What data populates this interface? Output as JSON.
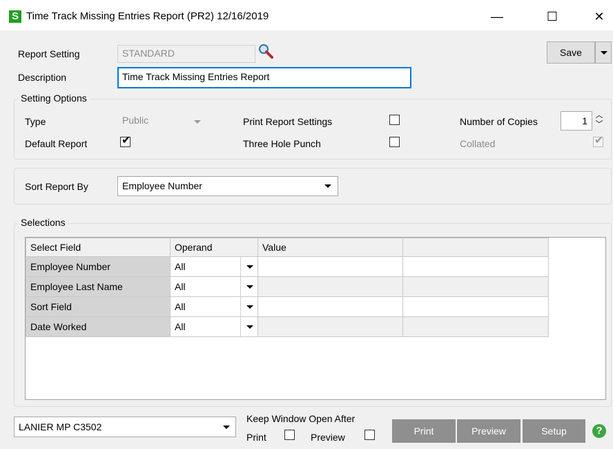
{
  "window": {
    "app_letter": "S",
    "title": "Time Track Missing Entries Report (PR2) 12/16/2019",
    "controls": {
      "minimize": "—",
      "maximize": "☐",
      "close": "✕"
    }
  },
  "header": {
    "report_setting_label": "Report Setting",
    "report_setting_value": "STANDARD",
    "description_label": "Description",
    "description_value": "Time Track Missing Entries Report",
    "save_label": "Save"
  },
  "setting_options": {
    "title": "Setting Options",
    "type_label": "Type",
    "type_value": "Public",
    "default_report_label": "Default Report",
    "default_report_checked": true,
    "print_report_settings_label": "Print Report Settings",
    "print_report_settings_checked": false,
    "three_hole_punch_label": "Three Hole Punch",
    "three_hole_punch_checked": false,
    "number_of_copies_label": "Number of Copies",
    "number_of_copies_value": "1",
    "collated_label": "Collated",
    "collated_checked": true
  },
  "sort": {
    "label": "Sort Report By",
    "value": "Employee Number"
  },
  "selections": {
    "title": "Selections",
    "columns": [
      "Select Field",
      "Operand",
      "Value",
      ""
    ],
    "rows": [
      {
        "field": "Employee Number",
        "operand": "All",
        "value": "",
        "extra": ""
      },
      {
        "field": "Employee Last Name",
        "operand": "All",
        "value": "",
        "extra": ""
      },
      {
        "field": "Sort Field",
        "operand": "All",
        "value": "",
        "extra": ""
      },
      {
        "field": "Date Worked",
        "operand": "All",
        "value": "",
        "extra": ""
      }
    ]
  },
  "footer": {
    "printer": "LANIER MP C3502",
    "keep_window_open_label": "Keep Window Open After",
    "print_check_label": "Print",
    "preview_check_label": "Preview",
    "print_button": "Print",
    "preview_button": "Preview",
    "setup_button": "Setup",
    "help": "?"
  }
}
